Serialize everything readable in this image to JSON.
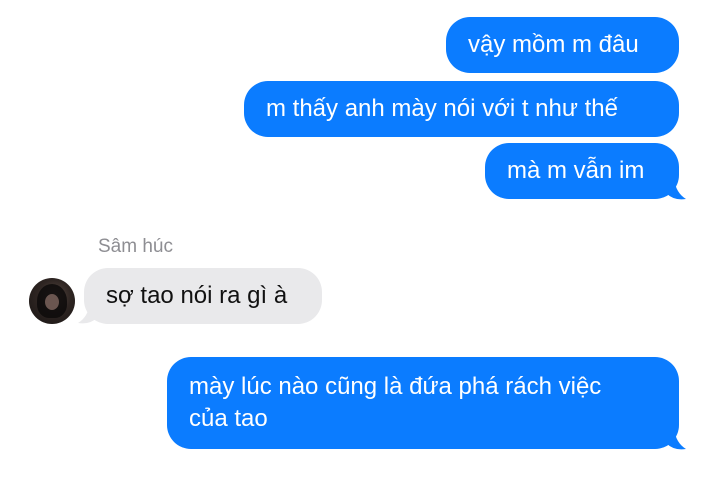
{
  "conversation": {
    "outgoing_1": "vậy mồm m đâu",
    "outgoing_2": "m thấy anh mày nói với t như thế",
    "outgoing_3": "mà m vẫn im",
    "incoming_sender": "Sâm húc",
    "incoming_1": "sợ tao nói ra gì à",
    "outgoing_4_line1": "mày lúc nào cũng là đứa phá rách việc",
    "outgoing_4_line2": "của tao"
  },
  "colors": {
    "outgoing_bubble": "#0b7cff",
    "incoming_bubble": "#e9e9eb",
    "sender_name": "#8e8e93"
  },
  "icons": {
    "avatar": "contact-avatar"
  }
}
